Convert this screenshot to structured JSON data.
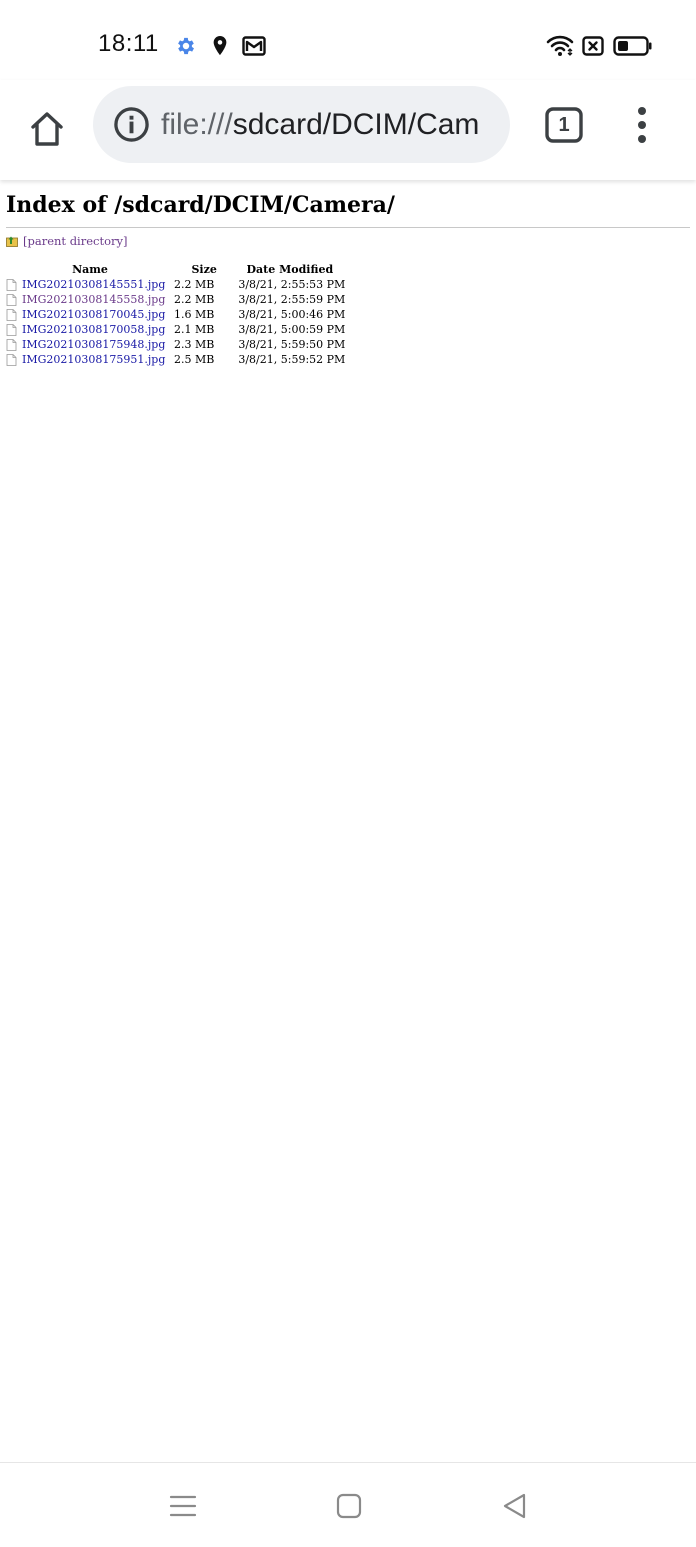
{
  "status_bar": {
    "time": "18:11",
    "icons": [
      "gear-icon",
      "location-pin-icon",
      "gmail-icon",
      "wifi-icon",
      "data-off-icon",
      "battery-icon"
    ]
  },
  "toolbar": {
    "url_scheme": "file:///",
    "url_host": "sdcard/DCIM/Cam",
    "tab_count": "1"
  },
  "page": {
    "title": "Index of /sdcard/DCIM/Camera/",
    "parent_label": "[parent directory]",
    "columns": {
      "name": "Name",
      "size": "Size",
      "date": "Date Modified"
    },
    "files": [
      {
        "name": "IMG20210308145551.jpg",
        "size": "2.2 MB",
        "date": "3/8/21, 2:55:53 PM",
        "visited": false
      },
      {
        "name": "IMG20210308145558.jpg",
        "size": "2.2 MB",
        "date": "3/8/21, 2:55:59 PM",
        "visited": true
      },
      {
        "name": "IMG20210308170045.jpg",
        "size": "1.6 MB",
        "date": "3/8/21, 5:00:46 PM",
        "visited": false
      },
      {
        "name": "IMG20210308170058.jpg",
        "size": "2.1 MB",
        "date": "3/8/21, 5:00:59 PM",
        "visited": false
      },
      {
        "name": "IMG20210308175948.jpg",
        "size": "2.3 MB",
        "date": "3/8/21, 5:59:50 PM",
        "visited": false
      },
      {
        "name": "IMG20210308175951.jpg",
        "size": "2.5 MB",
        "date": "3/8/21, 5:59:52 PM",
        "visited": false
      }
    ]
  },
  "colors": {
    "link": "#1a1aa6",
    "visited_link": "#6a3a8a",
    "gear_icon": "#4a86e8"
  }
}
